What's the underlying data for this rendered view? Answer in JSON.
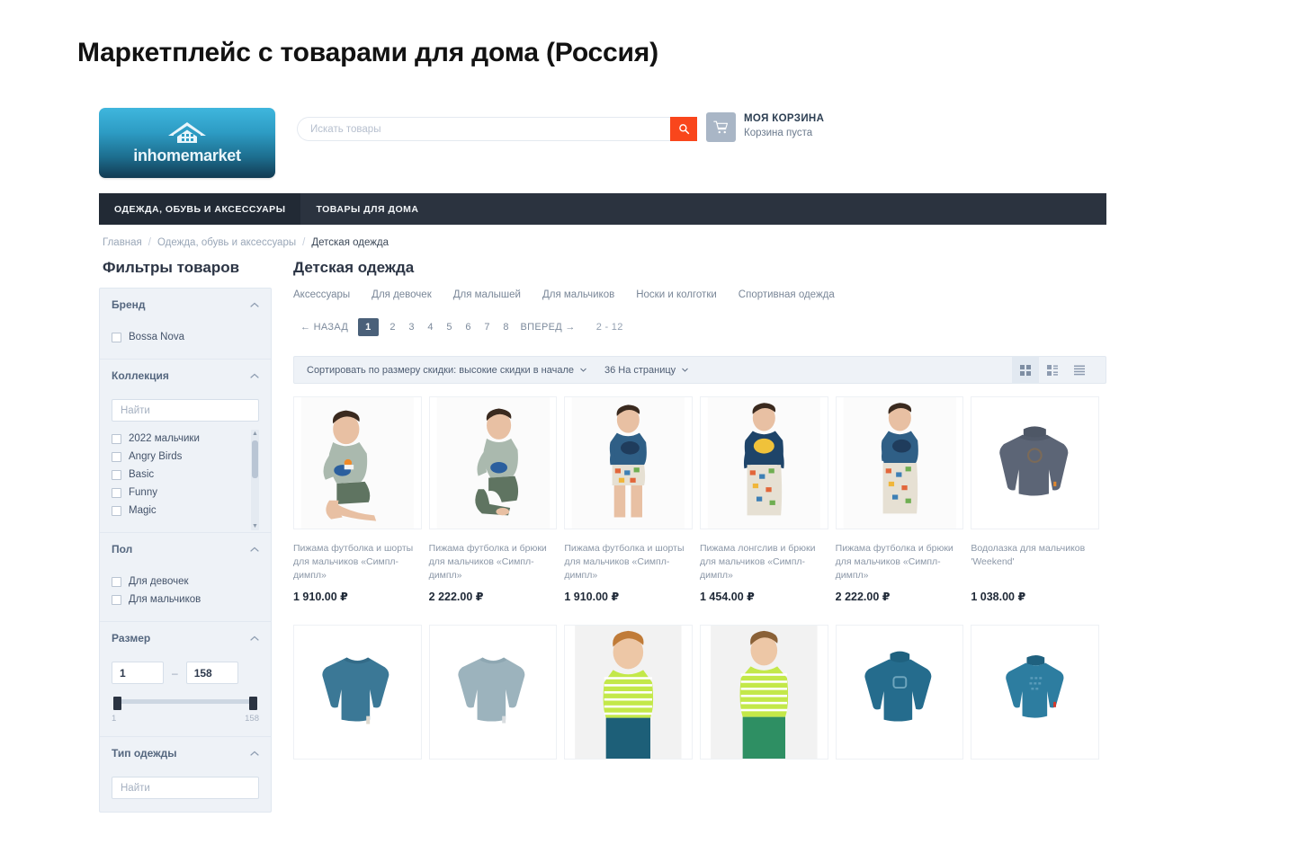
{
  "page_title": "Маркетплейс с товарами для дома (Россия)",
  "header": {
    "logo_text": "inhomemarket",
    "logo_icon": "house-icon",
    "search": {
      "placeholder": "Искать товары",
      "value": "",
      "button_icon": "search-icon"
    },
    "cart": {
      "icon": "shopping-cart-icon",
      "title": "МОЯ КОРЗИНА",
      "status": "Корзина пуста"
    }
  },
  "nav": {
    "items": [
      {
        "label": "ОДЕЖДА, ОБУВЬ И АКСЕССУАРЫ",
        "active": true
      },
      {
        "label": "ТОВАРЫ ДЛЯ ДОМА",
        "active": false
      }
    ]
  },
  "breadcrumb": {
    "items": [
      {
        "label": "Главная"
      },
      {
        "label": "Одежда, обувь и аксессуары"
      },
      {
        "label": "Детская одежда"
      }
    ],
    "separator": "/"
  },
  "sidebar": {
    "title": "Фильтры товаров",
    "groups": [
      {
        "title": "Бренд",
        "toggle_icon": "chevron-up-icon",
        "checkboxes": [
          {
            "label": "Bossa Nova",
            "checked": false
          }
        ]
      },
      {
        "title": "Коллекция",
        "toggle_icon": "chevron-up-icon",
        "search_placeholder": "Найти",
        "search_value": "",
        "checkboxes": [
          {
            "label": "2022 мальчики",
            "checked": false
          },
          {
            "label": "Angry Birds",
            "checked": false
          },
          {
            "label": "Basic",
            "checked": false
          },
          {
            "label": "Funny",
            "checked": false
          },
          {
            "label": "Magic",
            "checked": false
          }
        ]
      },
      {
        "title": "Пол",
        "toggle_icon": "chevron-up-icon",
        "checkboxes": [
          {
            "label": "Для девочек",
            "checked": false
          },
          {
            "label": "Для мальчиков",
            "checked": false
          }
        ]
      },
      {
        "title": "Размер",
        "toggle_icon": "chevron-up-icon",
        "range": {
          "min_value": "1",
          "max_value": "158",
          "min_label": "1",
          "max_label": "158"
        }
      },
      {
        "title": "Тип одежды",
        "toggle_icon": "chevron-up-icon",
        "search_placeholder": "Найти",
        "search_value": ""
      }
    ]
  },
  "main": {
    "category_title": "Детская одежда",
    "subcategories": [
      "Аксессуары",
      "Для девочек",
      "Для малышей",
      "Для мальчиков",
      "Носки и колготки",
      "Спортивная одежда"
    ],
    "pagination": {
      "prev_label": "← НАЗАД",
      "pages": [
        "1",
        "2",
        "3",
        "4",
        "5",
        "6",
        "7",
        "8"
      ],
      "active_page": "1",
      "next_label": "ВПЕРЕД →",
      "range_label": "2 - 12"
    },
    "toolbar": {
      "sort_label": "Сортировать по размеру скидки: высокие скидки в начале",
      "sort_caret": "caret-down-icon",
      "perpage_label": "36 На страницу",
      "perpage_caret": "caret-down-icon",
      "views": [
        {
          "icon": "grid-view-icon",
          "active": true
        },
        {
          "icon": "list-thumb-view-icon",
          "active": false
        },
        {
          "icon": "list-view-icon",
          "active": false
        }
      ]
    },
    "products": [
      {
        "title": "Пижама футболка и шорты для мальчиков «Симпл-димпл»",
        "price": "1 910.00 ₽",
        "image": "boy-sitting-gray-tshirt-green-shorts-photo"
      },
      {
        "title": "Пижама футболка и брюки для мальчиков «Симпл-димпл»",
        "price": "2 222.00 ₽",
        "image": "boy-kneeling-gray-tshirt-green-pants-photo"
      },
      {
        "title": "Пижама футболка и шорты для мальчиков «Симпл-димпл»",
        "price": "1 910.00 ₽",
        "image": "boy-standing-blue-tshirt-patterned-shorts-photo"
      },
      {
        "title": "Пижама лонгслив и брюки для мальчиков «Симпл-димпл»",
        "price": "1 454.00 ₽",
        "image": "boy-standing-navy-longsleeve-patterned-pants-photo"
      },
      {
        "title": "Пижама футболка и брюки для мальчиков «Симпл-димпл»",
        "price": "2 222.00 ₽",
        "image": "boy-standing-blue-tshirt-patterned-pants-photo"
      },
      {
        "title": "Водолазка для мальчиков 'Weekend'",
        "price": "1 038.00 ₽",
        "image": "gray-blue-turtleneck-flatlay"
      }
    ],
    "products_row2": [
      {
        "image": "teal-longsleeve-flatlay"
      },
      {
        "image": "light-blue-longsleeve-flatlay"
      },
      {
        "image": "toddler-green-striped-longsleeve-photo"
      },
      {
        "image": "boy-green-striped-longsleeve-photo"
      },
      {
        "image": "blue-turtleneck-square-logo-flatlay"
      },
      {
        "image": "blue-turtleneck-text-print-flatlay"
      }
    ]
  },
  "colors": {
    "accent_orange": "#f9461c",
    "nav_dark": "#2b333f",
    "panel_bg": "#eef2f7",
    "active_page": "#4a6079"
  }
}
